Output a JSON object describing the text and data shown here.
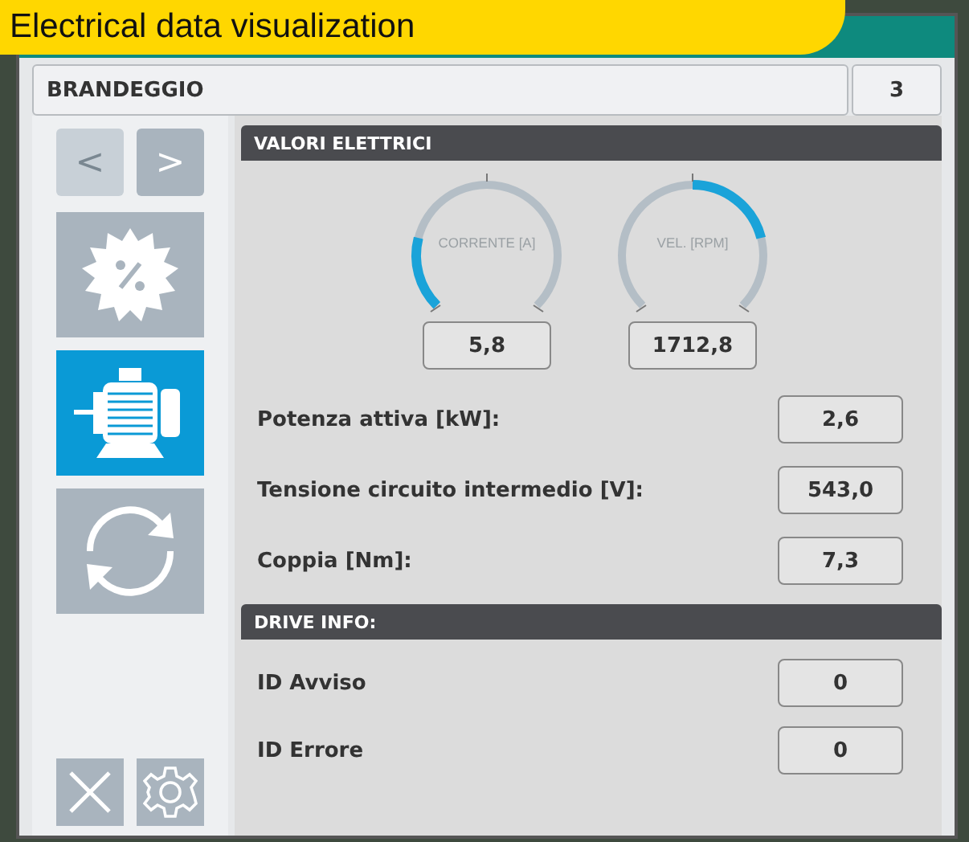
{
  "banner": {
    "title": "Electrical data visualization"
  },
  "header": {
    "name": "BRANDEGGIO",
    "number": "3"
  },
  "nav_buttons": [
    {
      "label": "<",
      "disabled": true
    },
    {
      "label": ">",
      "disabled": false
    }
  ],
  "sidebar": {
    "items": [
      {
        "kind": "percent",
        "selected": false
      },
      {
        "kind": "motor",
        "selected": true
      },
      {
        "kind": "refresh",
        "selected": false
      }
    ]
  },
  "electrical": {
    "title": "VALORI ELETTRICI",
    "gauges": [
      {
        "label": "CORRENTE [A]",
        "kind": "from_start",
        "value": "5,8"
      },
      {
        "label": "VEL. [RPM]",
        "kind": "from_center",
        "value": "1712,8"
      }
    ],
    "rows": [
      {
        "label": "Potenza attiva [kW]:",
        "value": "2,6"
      },
      {
        "label": "Tensione circuito intermedio [V]:",
        "value": "543,0"
      },
      {
        "label": "Coppia [Nm]:",
        "value": "7,3"
      }
    ]
  },
  "drive_info": {
    "title": "DRIVE INFO:",
    "rows": [
      {
        "label": "ID Avviso",
        "value": "0"
      },
      {
        "label": "ID Errore",
        "value": "0"
      }
    ]
  }
}
